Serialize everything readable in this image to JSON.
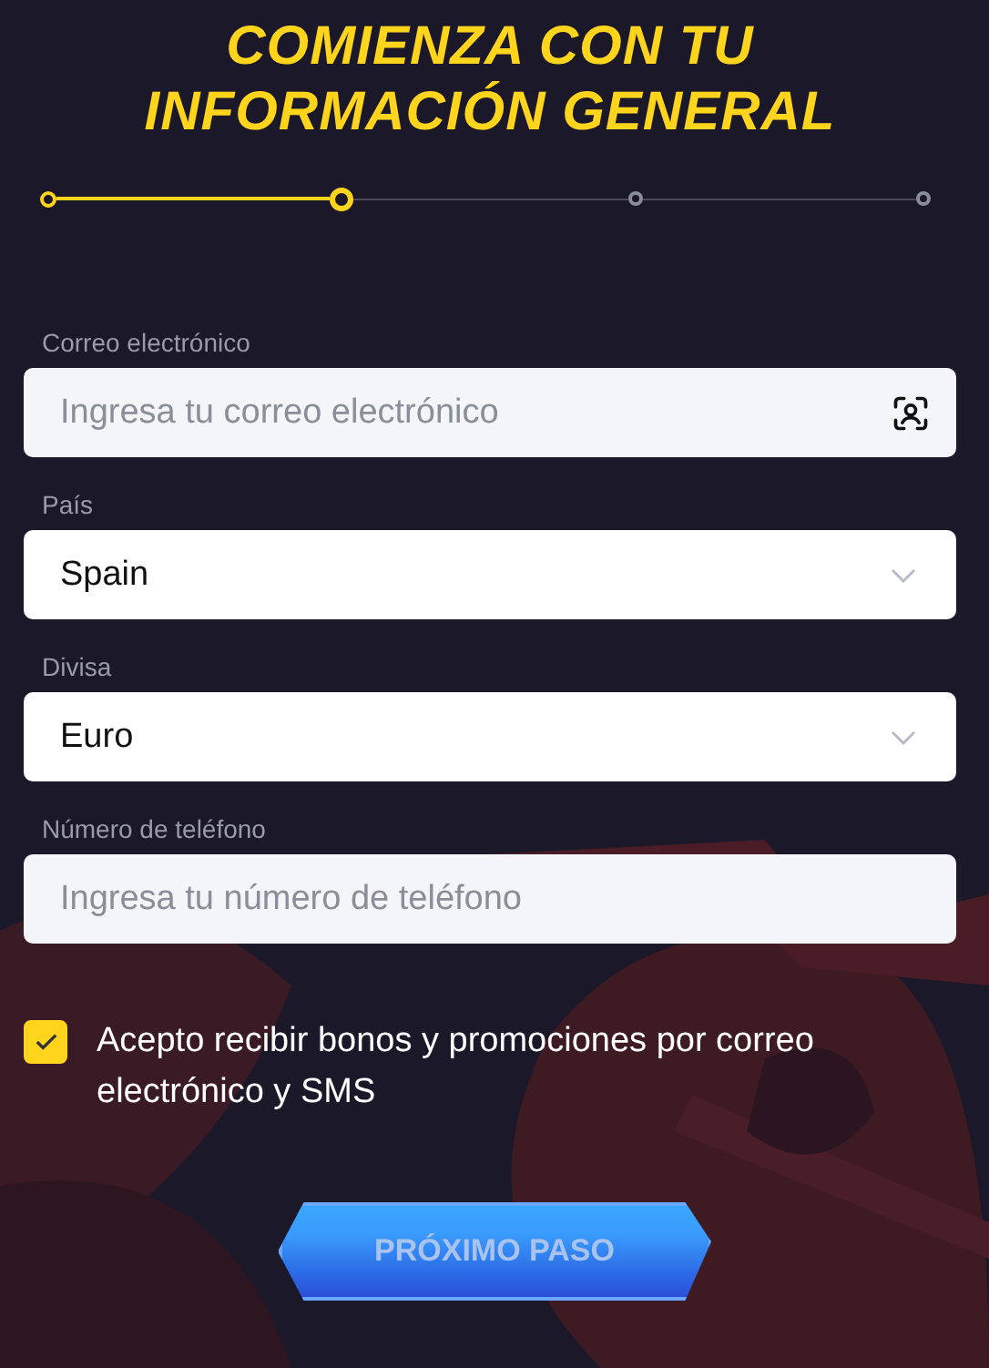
{
  "title": "COMIENZA CON TU INFORMACIÓN GENERAL",
  "steps": [
    {
      "kind": "done"
    },
    {
      "kind": "current"
    },
    {
      "kind": "upcoming"
    },
    {
      "kind": "upcoming"
    }
  ],
  "fields": [
    {
      "kind": "email",
      "label": "Correo electrónico",
      "placeholder": "Ingresa tu correo electrónico"
    },
    {
      "kind": "select",
      "label": "País",
      "value": "Spain"
    },
    {
      "kind": "select",
      "label": "Divisa",
      "value": "Euro"
    },
    {
      "kind": "text",
      "label": "Número de teléfono",
      "placeholder": "Ingresa tu número de teléfono"
    }
  ],
  "consent": {
    "checked": true,
    "text": "Acepto recibir bonos y promociones por correo electrónico y SMS"
  },
  "next_button": {
    "label": "PRÓXIMO PASO",
    "disabled": true
  }
}
